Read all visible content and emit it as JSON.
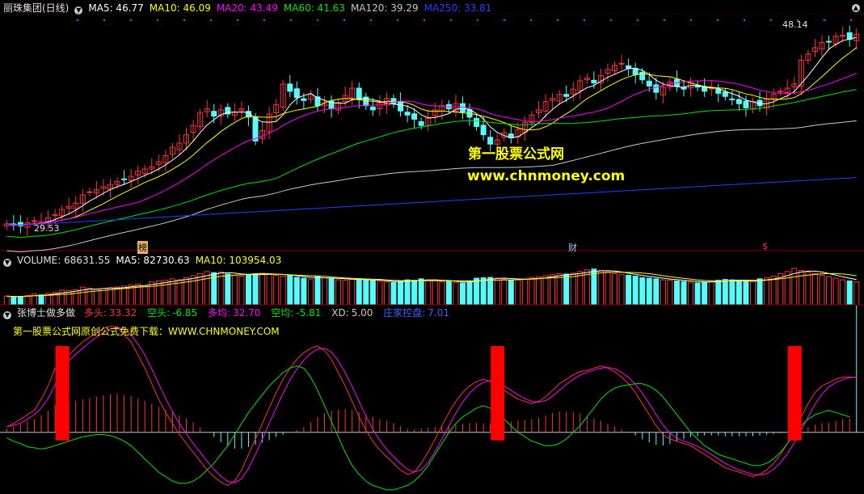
{
  "colors": {
    "bg": "#000000",
    "up": "#ff3232",
    "down": "#54fcfc",
    "ma5": "#ffffff",
    "ma10": "#ffff00",
    "ma20": "#ff00ff",
    "ma60": "#00e600",
    "ma120": "#c8c8c8",
    "ma250": "#2040ff",
    "duotou": "#ff3232",
    "kongtou": "#00e600",
    "duojun": "#ff00ff",
    "kongjun": "#00e600",
    "xd": "#c8c8c8",
    "zhuangjia": "#4060ff",
    "grid": "#800000"
  },
  "header": {
    "stock": "丽珠集团(日线)",
    "ma5": "MA5: 46.77",
    "ma10": "MA10: 46.09",
    "ma20": "MA20: 43.49",
    "ma60": "MA60: 41.63",
    "ma120": "MA120: 39.29",
    "ma250": "MA250: 33.81"
  },
  "volume_header": {
    "label": "VOLUME: 68631.55",
    "ma5": "MA5: 82730.63",
    "ma10": "MA10: 103954.03"
  },
  "indicator_header": {
    "name": "张博士做多做",
    "duotou_label": "多头:",
    "duotou_value": "33.32",
    "kongtou_label": "空头:",
    "kongtou_value": "-6.85",
    "duojun_label": "多均:",
    "duojun_value": "32.70",
    "kongjun_label": "空均:",
    "kongjun_value": "-5.81",
    "xd_label": "XD:",
    "xd_value": "5.00",
    "zhuangjia_label": "庄家控盘:",
    "zhuangjia_value": "7.01"
  },
  "watermark": {
    "line1": "第一股票公式网",
    "line2": "www.chnmoney.com",
    "note": "第一股票公式网原创公式免费下载：WWW.CHNMONEY.COM"
  },
  "markers": {
    "high_label": "48.14",
    "low_label": "29.53",
    "event1": "榜",
    "event2": "财",
    "event3": "$"
  },
  "chart_data": [
    {
      "type": "candlestick",
      "title": "丽珠集团(日线)",
      "annotations": [
        "48.14",
        "29.53"
      ],
      "close": [
        29.8,
        29.7,
        29.6,
        29.9,
        30.1,
        30.0,
        30.4,
        30.7,
        31.2,
        31.5,
        31.8,
        32.6,
        32.9,
        33.1,
        33.4,
        33.6,
        33.9,
        34.1,
        34.4,
        34.9,
        35.1,
        35.3,
        35.8,
        36.4,
        37.2,
        37.6,
        38.4,
        39.3,
        40.5,
        40.9,
        40.2,
        40.8,
        40.4,
        40.6,
        40.9,
        40.1,
        37.8,
        38.8,
        40.4,
        41.3,
        43.3,
        42.6,
        42.0,
        41.7,
        42.3,
        41.2,
        41.4,
        40.9,
        41.5,
        42.2,
        42.9,
        41.8,
        41.2,
        40.8,
        41.5,
        41.9,
        41.4,
        40.7,
        40.3,
        39.9,
        39.3,
        40.0,
        40.8,
        41.2,
        40.9,
        41.4,
        40.6,
        40.1,
        39.2,
        38.4,
        37.5,
        37.9,
        38.6,
        38.1,
        38.9,
        39.6,
        40.3,
        40.8,
        41.6,
        41.9,
        42.3,
        42.1,
        42.8,
        43.6,
        43.9,
        43.4,
        44.1,
        44.7,
        45.1,
        45.3,
        44.8,
        44.2,
        43.7,
        43.1,
        42.5,
        43.0,
        43.5,
        43.1,
        42.8,
        43.4,
        43.0,
        42.6,
        42.9,
        42.4,
        42.1,
        41.8,
        41.4,
        41.0,
        41.6,
        41.2,
        41.8,
        42.3,
        42.6,
        42.9,
        43.3,
        45.6,
        46.2,
        46.8,
        47.3,
        47.4,
        47.9,
        48.0,
        47.6,
        48.1
      ],
      "ylim": [
        28,
        50
      ]
    },
    {
      "type": "bar",
      "title": "VOLUME",
      "values": [
        42,
        38,
        40,
        45,
        52,
        48,
        55,
        60,
        70,
        68,
        72,
        85,
        80,
        75,
        78,
        82,
        86,
        90,
        95,
        100,
        92,
        110,
        115,
        118,
        125,
        120,
        130,
        140,
        150,
        160,
        155,
        158,
        148,
        142,
        138,
        145,
        150,
        152,
        148,
        142,
        138,
        140,
        132,
        128,
        124,
        135,
        130,
        126,
        120,
        118,
        122,
        125,
        118,
        116,
        112,
        110,
        108,
        115,
        120,
        118,
        125,
        120,
        118,
        110,
        112,
        108,
        105,
        115,
        128,
        130,
        132,
        128,
        124,
        118,
        120,
        125,
        130,
        135,
        140,
        145,
        150,
        148,
        152,
        160,
        168,
        172,
        165,
        158,
        150,
        145,
        142,
        138,
        130,
        128,
        125,
        120,
        118,
        115,
        112,
        108,
        105,
        110,
        115,
        118,
        122,
        120,
        118,
        115,
        112,
        125,
        130,
        138,
        150,
        160,
        175,
        165,
        158,
        150,
        142,
        135,
        128,
        120,
        115,
        110
      ]
    },
    {
      "type": "line",
      "title": "张博士做多做",
      "series": [
        {
          "name": "多头",
          "values": [
            5,
            8,
            12,
            16,
            20,
            30,
            42,
            58,
            66,
            70,
            76,
            82,
            86,
            90,
            94,
            96,
            95,
            88,
            82,
            70,
            58,
            44,
            30,
            18,
            8,
            -2,
            -10,
            -18,
            -26,
            -34,
            -40,
            -45,
            -48,
            -44,
            -34,
            -20,
            -6,
            8,
            22,
            36,
            48,
            58,
            66,
            72,
            76,
            78,
            74,
            66,
            54,
            42,
            28,
            14,
            2,
            -8,
            -16,
            -22,
            -28,
            -34,
            -38,
            -36,
            -28,
            -18,
            -6,
            6,
            18,
            28,
            36,
            42,
            46,
            48,
            46,
            42,
            38,
            34,
            30,
            28,
            26,
            28,
            32,
            38,
            44,
            48,
            52,
            55,
            56,
            58,
            60,
            58,
            55,
            50,
            44,
            36,
            26,
            16,
            6,
            -2,
            -6,
            -8,
            -10,
            -12,
            -16,
            -20,
            -24,
            -28,
            -32,
            -34,
            -36,
            -38,
            -40,
            -38,
            -34,
            -28,
            -20,
            -10,
            2,
            14,
            26,
            36,
            42,
            45,
            48,
            50,
            50,
            50
          ]
        },
        {
          "name": "空头",
          "values": [
            -5,
            -8,
            -10,
            -13,
            -14,
            -15,
            -14,
            -12,
            -10,
            -8,
            -6,
            -4,
            -3,
            -2,
            -2,
            -3,
            -5,
            -8,
            -12,
            -18,
            -24,
            -30,
            -36,
            -40,
            -44,
            -46,
            -46,
            -44,
            -40,
            -34,
            -28,
            -20,
            -12,
            -2,
            8,
            18,
            26,
            34,
            42,
            48,
            54,
            58,
            60,
            58,
            50,
            38,
            24,
            10,
            -4,
            -18,
            -30,
            -38,
            -44,
            -48,
            -50,
            -52,
            -52,
            -50,
            -48,
            -44,
            -38,
            -30,
            -20,
            -10,
            0,
            8,
            14,
            18,
            22,
            24,
            22,
            18,
            12,
            6,
            0,
            -4,
            -8,
            -10,
            -12,
            -12,
            -10,
            -6,
            0,
            6,
            14,
            22,
            30,
            36,
            40,
            42,
            43,
            44,
            44,
            42,
            38,
            32,
            24,
            16,
            8,
            0,
            -6,
            -12,
            -16,
            -20,
            -22,
            -24,
            -26,
            -28,
            -30,
            -30,
            -28,
            -24,
            -18,
            -10,
            -2,
            6,
            12,
            16,
            18,
            20,
            18,
            16,
            14
          ]
        }
      ],
      "ylim": [
        -55,
        100
      ]
    }
  ]
}
